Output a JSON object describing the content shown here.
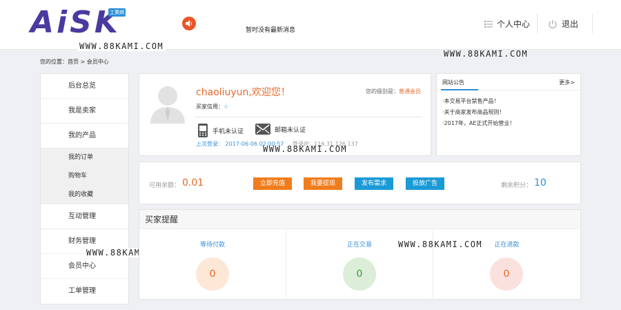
{
  "header": {
    "logo_text": "AiSK",
    "logo_badge": "工業網",
    "news": "暂时没有最新消息",
    "user_center": "个人中心",
    "logout": "退出"
  },
  "watermark": "WWW.88KAMI.COM",
  "breadcrumb": "您的位置：首页 > 会员中心",
  "sidebar": {
    "items": [
      {
        "label": "后台总览"
      },
      {
        "label": "我是卖家"
      },
      {
        "label": "我的产品"
      }
    ],
    "sub_items": [
      {
        "label": "我的订单"
      },
      {
        "label": "购物车"
      },
      {
        "label": "我的收藏"
      }
    ],
    "items_after": [
      {
        "label": "互动管理"
      },
      {
        "label": "财务管理"
      },
      {
        "label": "会员中心"
      },
      {
        "label": "工单管理"
      }
    ]
  },
  "profile": {
    "welcome": "chaoliuyun,欢迎您！",
    "level_label": "您的级别是：",
    "level_value": "普通会员",
    "credit_label": "买家信用：",
    "credit_star": "☆",
    "phone_verify": "手机未认证",
    "email_verify": "邮箱未认证",
    "last_login": "上次登录： 2017-06-06 02:00:57",
    "last_ip": "登录IP：116.31.126.137"
  },
  "notice": {
    "title": "网站公告",
    "more": "更多>",
    "items": [
      "·本交易平台禁售产品！",
      "·关于商家发布商品规则！",
      "·2017年，AE正式开始营业！"
    ]
  },
  "balance": {
    "label": "可用余额：",
    "value": "0.01",
    "buttons": [
      {
        "label": "立即充值",
        "color": "#f07d1d"
      },
      {
        "label": "我要提现",
        "color": "#f07d1d"
      },
      {
        "label": "发布需求",
        "color": "#1a9ad6"
      },
      {
        "label": "投放广告",
        "color": "#1a9ad6"
      }
    ],
    "points_label": "剩余积分：",
    "points_value": "10"
  },
  "remind": {
    "title": "买家提醒",
    "cols": [
      {
        "label": "等待付款",
        "count": "0",
        "bg": "#fde7d7",
        "fg": "#e8692c"
      },
      {
        "label": "正在交易",
        "count": "0",
        "bg": "#dcedd8",
        "fg": "#3a9a3a"
      },
      {
        "label": "正在退款",
        "count": "0",
        "bg": "#fbe1dd",
        "fg": "#e8692c"
      }
    ]
  }
}
